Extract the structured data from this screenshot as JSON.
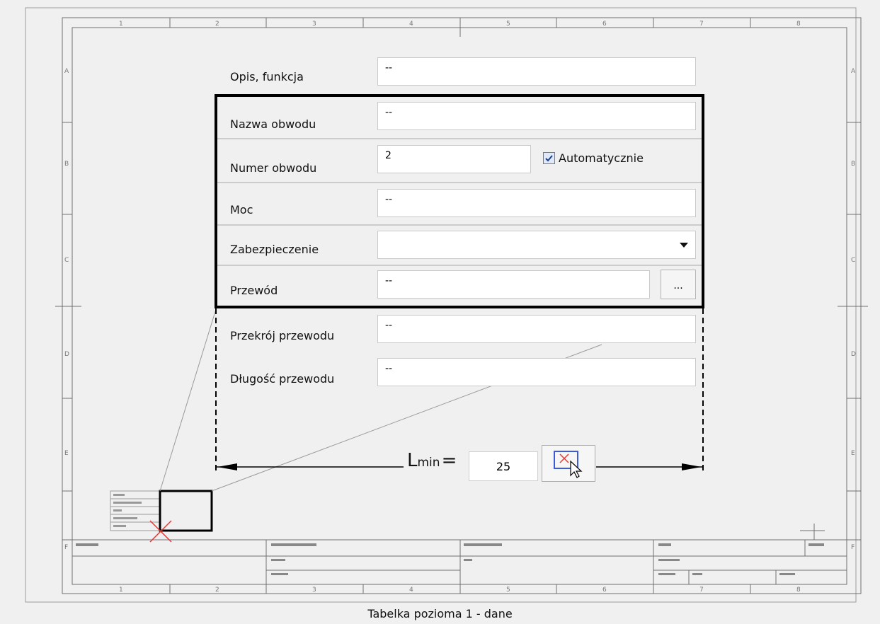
{
  "fields": {
    "opis": {
      "label": "Opis, funkcja",
      "value": "--"
    },
    "nazwa": {
      "label": "Nazwa obwodu",
      "value": "--"
    },
    "numer": {
      "label": "Numer obwodu",
      "value": "2"
    },
    "moc": {
      "label": "Moc",
      "value": "--"
    },
    "zabezpieczenie": {
      "label": "Zabezpieczenie",
      "value": ""
    },
    "przewod": {
      "label": "Przewód",
      "value": "--"
    },
    "przekroj": {
      "label": "Przekrój przewodu",
      "value": "--"
    },
    "dlugosc": {
      "label": "Długość przewodu",
      "value": "--"
    }
  },
  "auto_checkbox": {
    "label": "Automatycznie",
    "checked": true
  },
  "browse_button": {
    "label": "..."
  },
  "lmin": {
    "label_main": "L",
    "label_sub": "min",
    "equals": "=",
    "value": "25"
  },
  "caption": "Tabelka pozioma 1 - dane",
  "colors": {
    "accent": "#3b5bdb",
    "cross": "#e53935"
  }
}
